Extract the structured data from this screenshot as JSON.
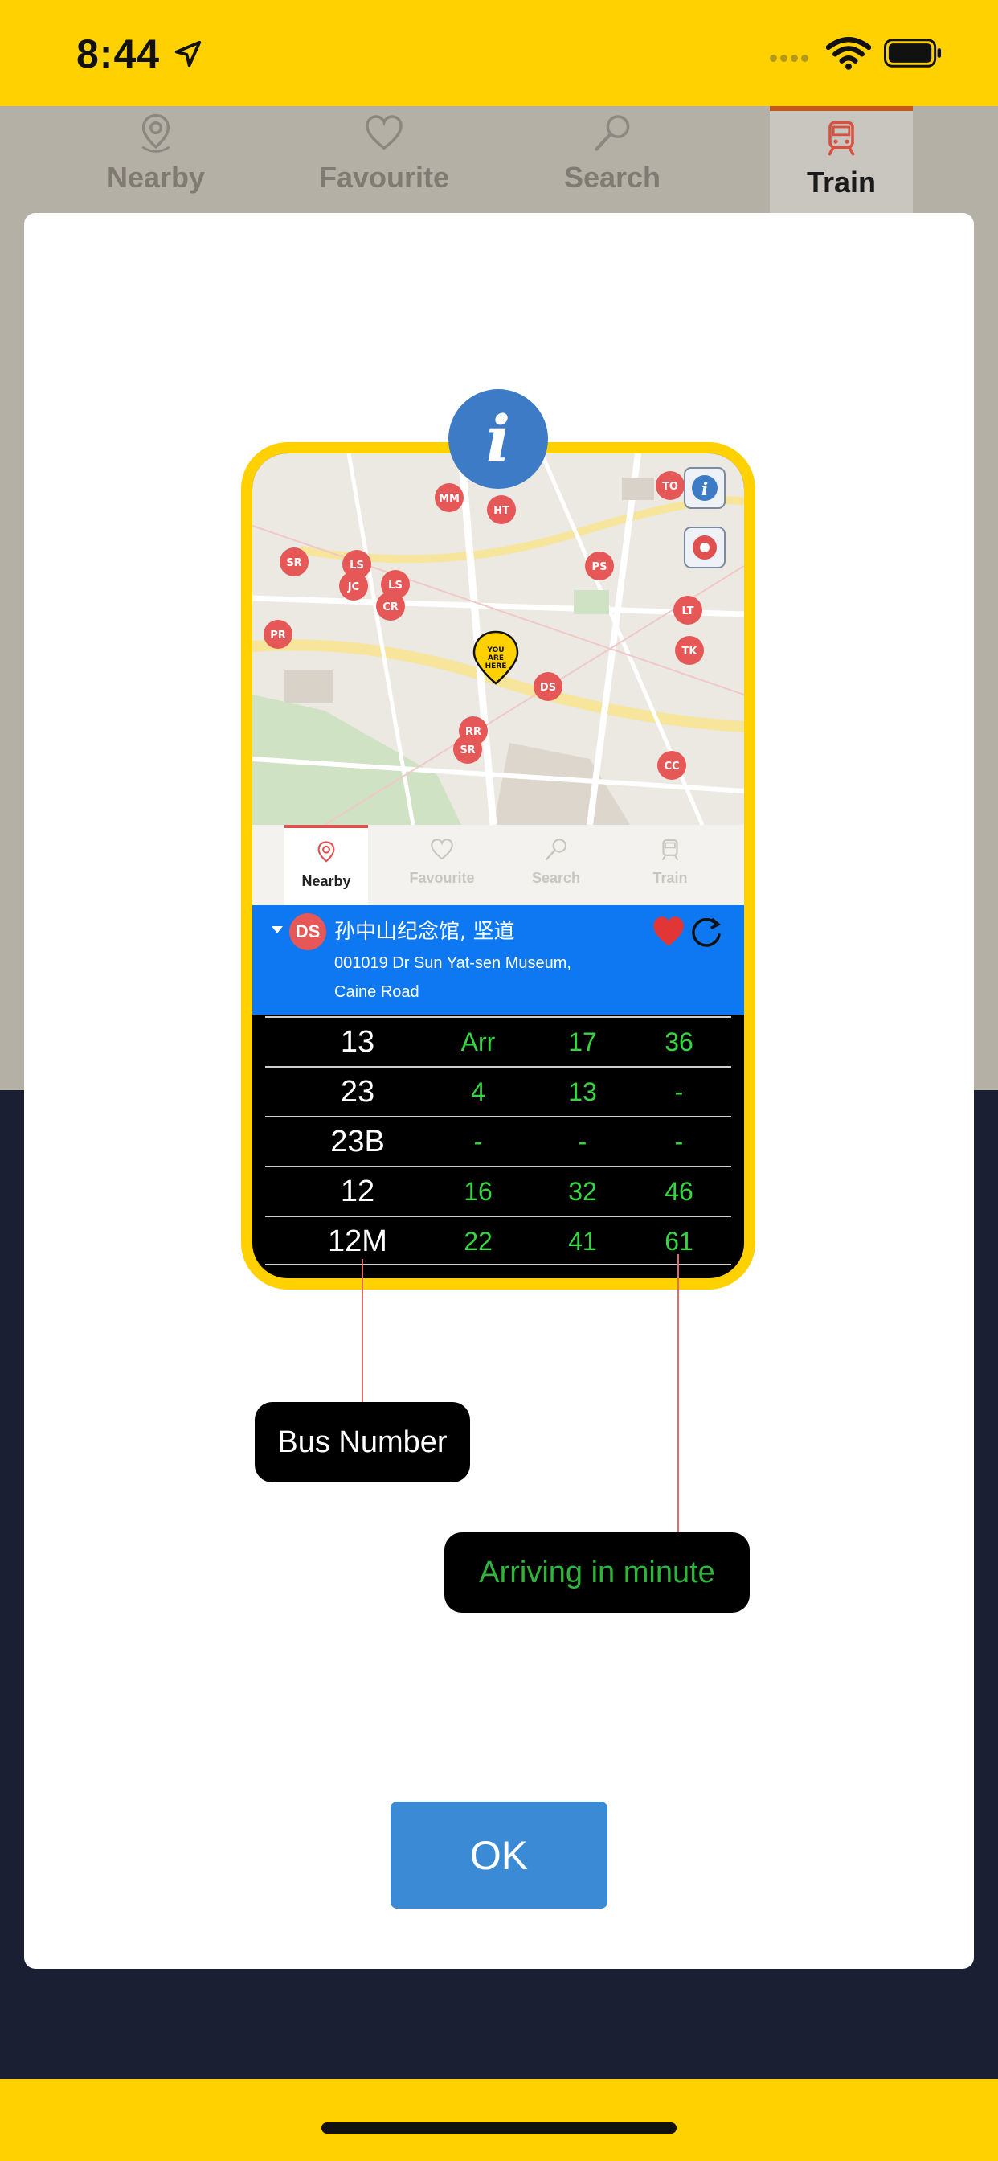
{
  "status_bar": {
    "time": "8:44"
  },
  "tabs": [
    {
      "label": "Nearby",
      "icon": "location-pin-icon",
      "active": false
    },
    {
      "label": "Favourite",
      "icon": "heart-icon",
      "active": false
    },
    {
      "label": "Search",
      "icon": "search-icon",
      "active": false
    },
    {
      "label": "Train",
      "icon": "train-icon",
      "active": true
    }
  ],
  "modal": {
    "info_icon": "i",
    "illustration": {
      "map_markers": [
        "MM",
        "HT",
        "TO",
        "SR",
        "LS",
        "JC",
        "LS",
        "CR",
        "PS",
        "PR",
        "LT",
        "TK",
        "DS",
        "RR",
        "SR",
        "CC"
      ],
      "you_are_here": "YOU ARE HERE",
      "tabs": [
        {
          "label": "Nearby",
          "active": true
        },
        {
          "label": "Favourite",
          "active": false
        },
        {
          "label": "Search",
          "active": false
        },
        {
          "label": "Train",
          "active": false
        }
      ],
      "stop": {
        "code": "DS",
        "name": "孙中山纪念馆, 坚道",
        "address_line1": "001019 Dr Sun Yat-sen Museum,",
        "address_line2": "Caine Road"
      },
      "eta_rows": [
        {
          "route": "13",
          "t1": "Arr",
          "t2": "17",
          "t3": "36"
        },
        {
          "route": "23",
          "t1": "4",
          "t2": "13",
          "t3": "-"
        },
        {
          "route": "23B",
          "t1": "-",
          "t2": "-",
          "t3": "-"
        },
        {
          "route": "12",
          "t1": "16",
          "t2": "32",
          "t3": "46"
        },
        {
          "route": "12M",
          "t1": "22",
          "t2": "41",
          "t3": "61"
        }
      ]
    },
    "callout_bus_number": "Bus Number",
    "callout_arriving": "Arriving in minute",
    "ok_label": "OK"
  },
  "colors": {
    "brand_yellow": "#ffd100",
    "info_blue": "#3d7bc6",
    "stop_blue": "#0d78f2",
    "eta_green": "#35d641",
    "ok_blue": "#3a8ad6"
  }
}
